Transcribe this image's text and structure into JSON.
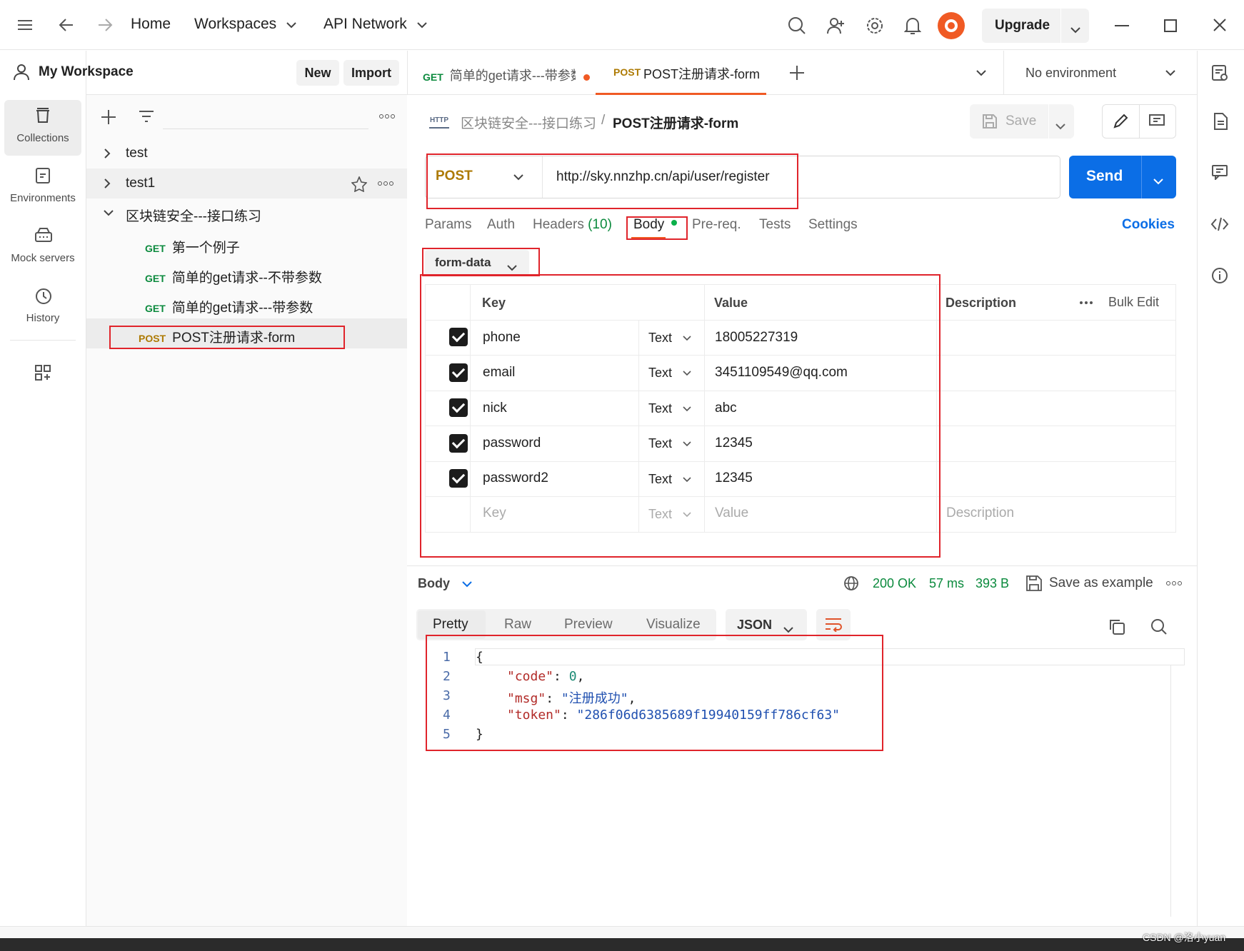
{
  "topbar": {
    "home": "Home",
    "workspaces": "Workspaces",
    "api_network": "API Network",
    "upgrade": "Upgrade"
  },
  "workspace": {
    "title": "My Workspace",
    "new_label": "New",
    "import_label": "Import"
  },
  "sidebar_nav": [
    {
      "label": "Collections",
      "icon": "collections-icon"
    },
    {
      "label": "Environments",
      "icon": "environments-icon"
    },
    {
      "label": "Mock servers",
      "icon": "mock-servers-icon"
    },
    {
      "label": "History",
      "icon": "history-icon"
    }
  ],
  "tree": {
    "items": [
      {
        "label": "test"
      },
      {
        "label": "test1"
      },
      {
        "label": "区块链安全---接口练习"
      }
    ],
    "requests": [
      {
        "method": "GET",
        "label": "第一个例子"
      },
      {
        "method": "GET",
        "label": "简单的get请求--不带参数"
      },
      {
        "method": "GET",
        "label": "简单的get请求---带参数"
      },
      {
        "method": "POST",
        "label": "POST注册请求-form"
      }
    ]
  },
  "tabs": [
    {
      "method": "GET",
      "label": "简单的get请求---带参数"
    },
    {
      "method": "POST",
      "label": "POST注册请求-form"
    }
  ],
  "environment": "No environment",
  "breadcrumb": {
    "http_badge": "HTTP",
    "collection": "区块链安全---接口练习",
    "separator": "/",
    "request": "POST注册请求-form"
  },
  "save_label": "Save",
  "request": {
    "method": "POST",
    "url": "http://sky.nnzhp.cn/api/user/register",
    "send_label": "Send"
  },
  "req_tabs": {
    "params": "Params",
    "auth": "Auth",
    "headers": "Headers",
    "headers_count": "(10)",
    "body": "Body",
    "prereq": "Pre-req.",
    "tests": "Tests",
    "settings": "Settings",
    "cookies": "Cookies"
  },
  "body_mode": "form-data",
  "form_table": {
    "headers": {
      "key": "Key",
      "value": "Value",
      "description": "Description",
      "bulk_edit": "Bulk Edit"
    },
    "rows": [
      {
        "key": "phone",
        "type": "Text",
        "value": "18005227319"
      },
      {
        "key": "email",
        "type": "Text",
        "value": "3451109549@qq.com"
      },
      {
        "key": "nick",
        "type": "Text",
        "value": "abc"
      },
      {
        "key": "password",
        "type": "Text",
        "value": "12345"
      },
      {
        "key": "password2",
        "type": "Text",
        "value": "12345"
      }
    ],
    "placeholder": {
      "key": "Key",
      "type": "Text",
      "value": "Value",
      "description": "Description"
    }
  },
  "response": {
    "body_label": "Body",
    "status": "200 OK",
    "time": "57 ms",
    "size": "393 B",
    "save_example": "Save as example",
    "view_tabs": [
      "Pretty",
      "Raw",
      "Preview",
      "Visualize"
    ],
    "format": "JSON",
    "code_lines": [
      {
        "n": "1",
        "text": "{"
      },
      {
        "n": "2",
        "key": "\"code\"",
        "val": "0",
        "type": "num"
      },
      {
        "n": "3",
        "key": "\"msg\"",
        "val": "\"注册成功\"",
        "type": "str"
      },
      {
        "n": "4",
        "key": "\"token\"",
        "val": "\"286f06d6385689f19940159ff786cf63\"",
        "type": "str"
      },
      {
        "n": "5",
        "text": "}"
      }
    ]
  },
  "watermark": "CSDN @洛小yuan",
  "colors": {
    "accent": "#0b6ee6",
    "get": "#0b8a3d",
    "post": "#ad7a03",
    "annotation": "#e0242b",
    "ok": "#0b8a3d"
  }
}
